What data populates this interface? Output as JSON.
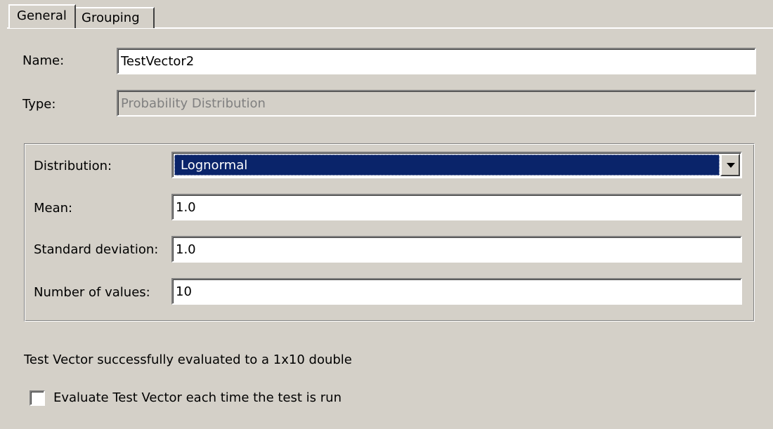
{
  "tabs": [
    {
      "label": "General",
      "selected": true
    },
    {
      "label": "Grouping",
      "selected": false
    }
  ],
  "general": {
    "name_label": "Name:",
    "name_value": "TestVector2",
    "type_label": "Type:",
    "type_value": "Probability Distribution"
  },
  "distribution": {
    "distribution_label": "Distribution:",
    "distribution_value": "Lognormal",
    "mean_label": "Mean:",
    "mean_value": "1.0",
    "std_label": "Standard deviation:",
    "std_value": "1.0",
    "count_label": "Number of values:",
    "count_value": "10"
  },
  "status": {
    "message": "Test Vector successfully evaluated to a 1x10 double",
    "checkbox_label": "Evaluate Test Vector each time the test is run",
    "checkbox_checked": false
  },
  "colors": {
    "background": "#d4d0c8",
    "selection": "#0a246a"
  }
}
